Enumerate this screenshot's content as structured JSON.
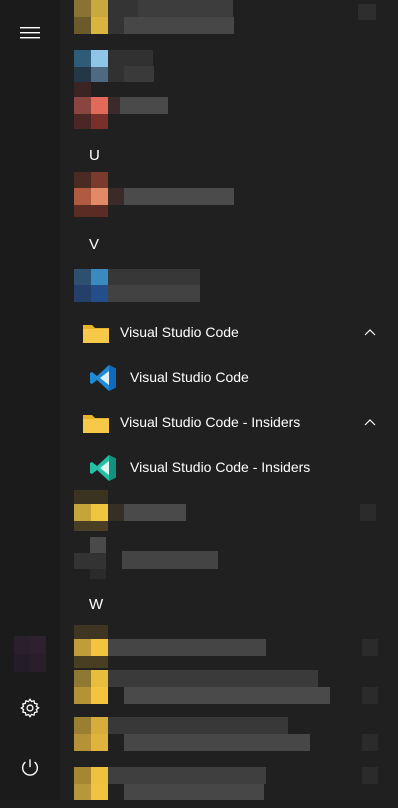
{
  "sections": {
    "u": "U",
    "v": "V",
    "w": "W"
  },
  "apps": {
    "vscode_folder": "Visual Studio Code",
    "vscode": "Visual Studio Code",
    "insiders_folder": "Visual Studio Code - Insiders",
    "insiders": "Visual Studio Code - Insiders"
  },
  "icons": {
    "menu": "hamburger-icon",
    "settings": "gear-icon",
    "power": "power-icon",
    "folder": "folder-icon",
    "chevron": "chevron-up-icon"
  },
  "colors": {
    "background": "#202020",
    "rail": "#1b1b1b",
    "folder": "#f4c430",
    "vscode_blue": "#1f8ad6",
    "insiders_green": "#24bfa5"
  }
}
